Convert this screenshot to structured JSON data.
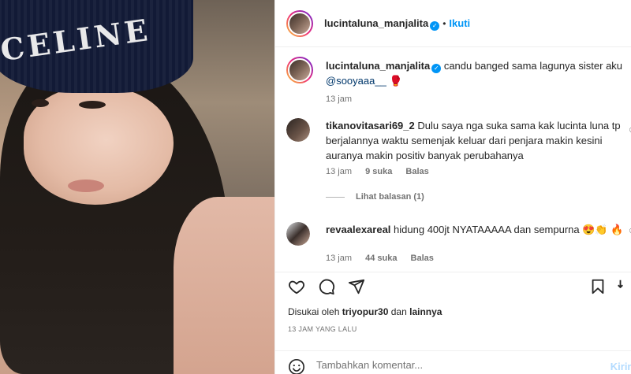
{
  "photo": {
    "beanie_text": "CELINE"
  },
  "header": {
    "username": "lucintaluna_manjalita",
    "follow_label": "Ikuti",
    "separator": "•"
  },
  "caption": {
    "username": "lucintaluna_manjalita",
    "text": "candu banged sama lagunya sister aku",
    "mention": "@sooyaaa__",
    "emoji": "🥊",
    "time": "13 jam"
  },
  "comments": [
    {
      "username": "tikanovitasari69_2",
      "text": "Dulu saya nga suka sama kak lucinta luna tp berjalannya waktu semenjak keluar dari penjara makin kesini auranya makin positiv banyak perubahanya",
      "time": "13 jam",
      "likes": "9 suka",
      "reply_label": "Balas",
      "view_replies": "Lihat balasan (1)"
    },
    {
      "username": "revaalexareal",
      "text": "hidung 400jt NYATAAAAA dan sempurna 😍👏 🔥",
      "time": "13 jam",
      "likes": "44 suka",
      "reply_label": "Balas"
    }
  ],
  "liked_by": {
    "prefix": "Disukai oleh",
    "user": "triyopur30",
    "conj": "dan",
    "others": "lainnya"
  },
  "post_time": "13 JAM YANG LALU",
  "add_comment": {
    "placeholder": "Tambahkan komentar...",
    "post_label": "Kirim"
  },
  "icons": {
    "verified": "verified-badge-icon",
    "like": "heart-icon",
    "comment": "comment-icon",
    "share": "share-icon",
    "save": "bookmark-icon",
    "emoji": "emoji-icon"
  },
  "colors": {
    "accent": "#0095f6",
    "text": "#262626",
    "muted": "#737373",
    "post_disabled": "#b3dbff"
  }
}
